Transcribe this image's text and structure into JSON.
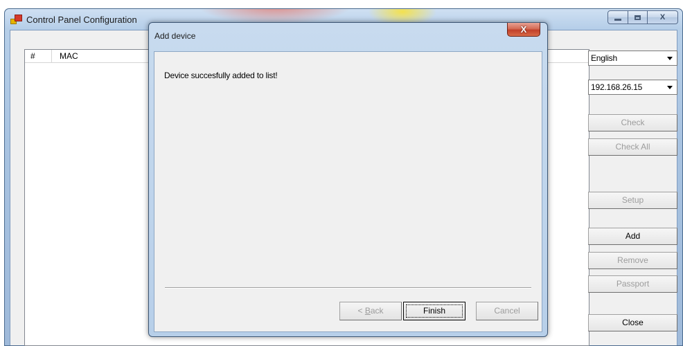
{
  "main_window": {
    "title": "Control Panel Configuration",
    "controls": {
      "close_glyph": "X"
    }
  },
  "device_list": {
    "columns": [
      "#",
      "MAC"
    ],
    "rows": []
  },
  "language_select": {
    "selected": "English"
  },
  "ip_select": {
    "selected": "192.168.26.15"
  },
  "side_buttons": {
    "check": "Check",
    "check_all": "Check All",
    "setup": "Setup",
    "add": "Add",
    "remove": "Remove",
    "passport": "Passport",
    "close": "Close"
  },
  "dialog": {
    "title": "Add device",
    "close_glyph": "X",
    "message": "Device succesfully added to list!",
    "buttons": {
      "back_prefix": "< ",
      "back_mnemonic": "B",
      "back_rest": "ack",
      "finish": "Finish",
      "cancel": "Cancel"
    }
  }
}
